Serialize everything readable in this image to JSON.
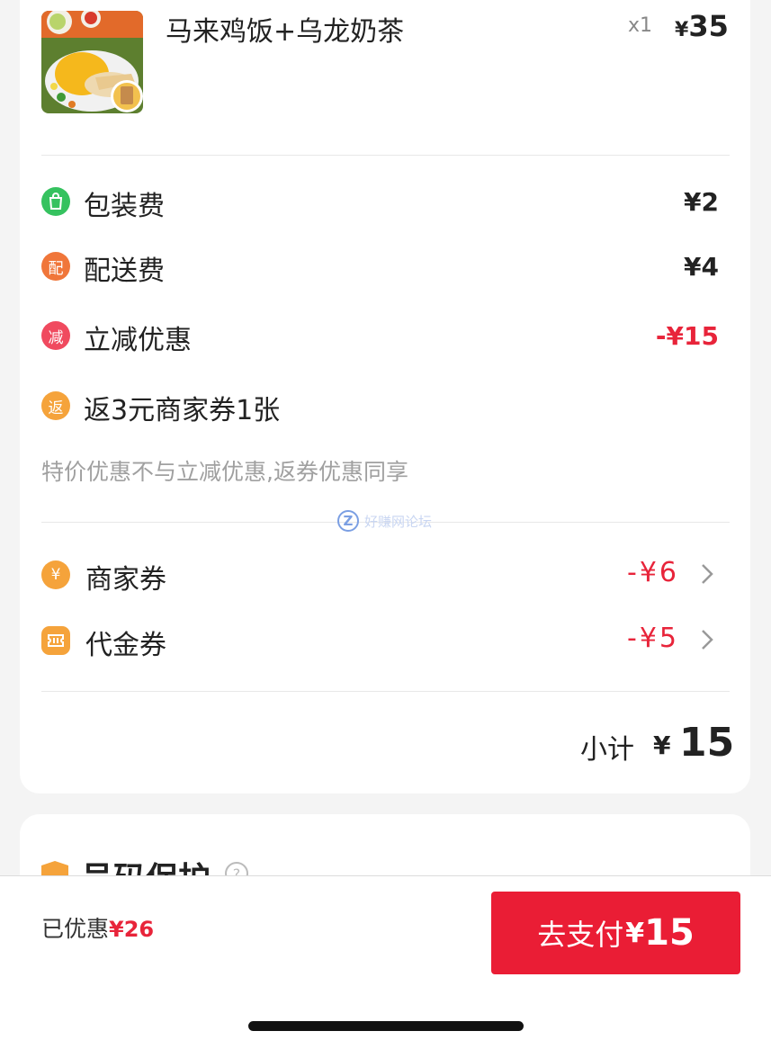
{
  "order_item": {
    "image": "food-thumbnail",
    "name": "马来鸡饭+乌龙奶茶",
    "qty": "x1",
    "price_symbol": "¥",
    "price": "35"
  },
  "fees": [
    {
      "icon": "bag-icon",
      "icon_char": "",
      "label": "包装费",
      "value": "¥2",
      "color": "#35c25f"
    },
    {
      "icon": "delivery-icon",
      "icon_char": "配",
      "label": "配送费",
      "value": "¥4",
      "color": "#f0763a"
    },
    {
      "icon": "discount-icon",
      "icon_char": "减",
      "label": "立减优惠",
      "value": "-¥15",
      "color": "#f04a5f"
    },
    {
      "icon": "rebate-icon",
      "icon_char": "返",
      "label": "返3元商家券1张",
      "value": "",
      "color": "#f5a33b"
    }
  ],
  "note": "特价优惠不与立减优惠,返券优惠同享",
  "watermark": {
    "icon_char": "Z",
    "text": "好赚网论坛"
  },
  "coupons": [
    {
      "icon": "yen-coupon-icon",
      "icon_char": "¥",
      "label": "商家券",
      "value": "-¥6"
    },
    {
      "icon": "voucher-icon",
      "label": "代金券",
      "value": "-¥5"
    }
  ],
  "subtotal": {
    "label": "小计",
    "symbol": "¥",
    "value": "15"
  },
  "privacy_section": {
    "title": "号码保护",
    "help_char": "?"
  },
  "bottom_bar": {
    "saved_label": "已优惠",
    "saved_amount": "¥26",
    "pay_label": "去支付",
    "pay_symbol": "¥",
    "pay_amount": "15"
  },
  "colors": {
    "accent_red": "#ea1d35",
    "discount_red": "#e8243a",
    "icon_orange": "#f5a33b"
  }
}
